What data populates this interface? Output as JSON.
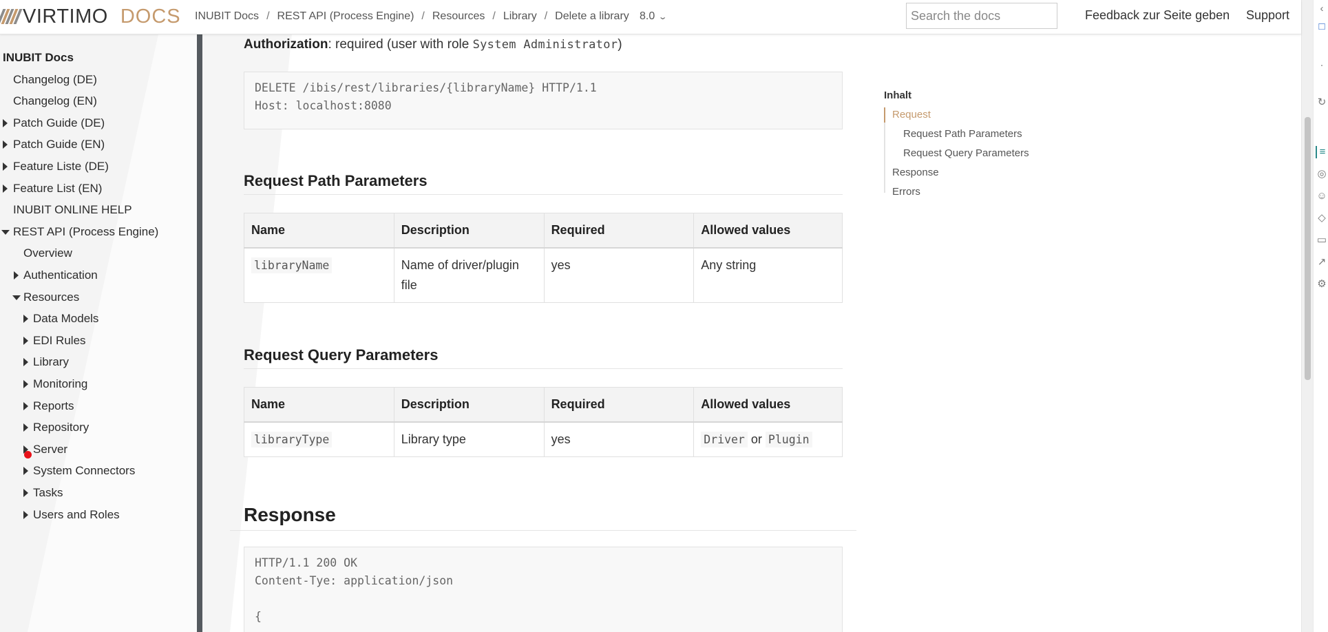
{
  "header": {
    "logo_word": "VIRTIMO",
    "logo_docs": "DOCS",
    "breadcrumb": [
      "INUBIT Docs",
      "REST API (Process Engine)",
      "Resources",
      "Library",
      "Delete a library"
    ],
    "version": "8.0",
    "search_placeholder": "Search the docs",
    "feedback": "Feedback zur Seite geben",
    "support": "Support",
    "logo_colors": [
      "#8c8c8c",
      "#c59a6d",
      "#8c8c8c",
      "#c59a6d",
      "#8c8c8c"
    ]
  },
  "sidebar": {
    "items": [
      {
        "label": "INUBIT Docs",
        "level": 0,
        "caret": "none"
      },
      {
        "label": "Changelog (DE)",
        "level": 1,
        "caret": "none"
      },
      {
        "label": "Changelog (EN)",
        "level": 1,
        "caret": "none"
      },
      {
        "label": "Patch Guide (DE)",
        "level": 1,
        "caret": "right"
      },
      {
        "label": "Patch Guide (EN)",
        "level": 1,
        "caret": "right"
      },
      {
        "label": "Feature Liste (DE)",
        "level": 1,
        "caret": "right"
      },
      {
        "label": "Feature List (EN)",
        "level": 1,
        "caret": "right"
      },
      {
        "label": "INUBIT ONLINE HELP",
        "level": 1,
        "caret": "none"
      },
      {
        "label": "REST API (Process Engine)",
        "level": 1,
        "caret": "down"
      },
      {
        "label": "Overview",
        "level": 2,
        "caret": "none"
      },
      {
        "label": "Authentication",
        "level": 2,
        "caret": "right"
      },
      {
        "label": "Resources",
        "level": 2,
        "caret": "down"
      },
      {
        "label": "Data Models",
        "level": 3,
        "caret": "right"
      },
      {
        "label": "EDI Rules",
        "level": 3,
        "caret": "right"
      },
      {
        "label": "Library",
        "level": 3,
        "caret": "right"
      },
      {
        "label": "Monitoring",
        "level": 3,
        "caret": "right"
      },
      {
        "label": "Reports",
        "level": 3,
        "caret": "right"
      },
      {
        "label": "Repository",
        "level": 3,
        "caret": "right"
      },
      {
        "label": "Server",
        "level": 3,
        "caret": "right"
      },
      {
        "label": "System Connectors",
        "level": 3,
        "caret": "right"
      },
      {
        "label": "Tasks",
        "level": 3,
        "caret": "right"
      },
      {
        "label": "Users and Roles",
        "level": 3,
        "caret": "right"
      }
    ]
  },
  "content": {
    "auth_label": "Authorization",
    "auth_text": ": required (user with role ",
    "auth_role": "System Administrator",
    "auth_close": ")",
    "request_code": "DELETE /ibis/rest/libraries/{libraryName} HTTP/1.1\nHost: localhost:8080",
    "path_params_title": "Request Path Parameters",
    "path_params": {
      "headers": [
        "Name",
        "Description",
        "Required",
        "Allowed values"
      ],
      "rows": [
        {
          "name": "libraryName",
          "description": "Name of driver/plugin file",
          "required": "yes",
          "allowed": "Any string"
        }
      ]
    },
    "query_params_title": "Request Query Parameters",
    "query_params": {
      "headers": [
        "Name",
        "Description",
        "Required",
        "Allowed values"
      ],
      "rows": [
        {
          "name": "libraryType",
          "description": "Library type",
          "required": "yes",
          "allowed_a": "Driver",
          "allowed_or": "or",
          "allowed_b": "Plugin"
        }
      ]
    },
    "response_title": "Response",
    "response_code": "HTTP/1.1 200 OK\nContent-Tye: application/json\n\n{"
  },
  "toc": {
    "title": "Inhalt",
    "items": [
      {
        "label": "Request",
        "level": 0,
        "active": true
      },
      {
        "label": "Request Path Parameters",
        "level": 1,
        "active": false
      },
      {
        "label": "Request Query Parameters",
        "level": 1,
        "active": false
      },
      {
        "label": "Response",
        "level": 0,
        "active": false
      },
      {
        "label": "Errors",
        "level": 0,
        "active": false
      }
    ]
  },
  "colors": {
    "accent": "#c59a6d",
    "sidebar_bg": "#f4f4f4",
    "sidebar_border": "#555a5f",
    "cursor": "#e8121a"
  },
  "rail_icons": [
    "back-arrow-icon",
    "bookmark-icon",
    "brand-icon",
    "history-icon",
    "notes-icon",
    "globe-icon",
    "person-icon",
    "tag-icon",
    "tablet-icon",
    "chart-icon",
    "settings-icon"
  ]
}
